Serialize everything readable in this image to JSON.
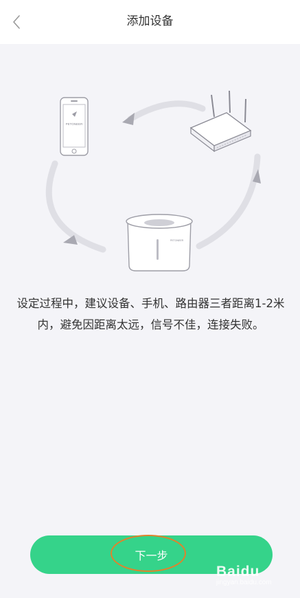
{
  "header": {
    "title": "添加设备",
    "back_icon": "chevron-left-icon"
  },
  "illustration": {
    "phone_brand": "PETONEER",
    "device_brand": "PETONEER"
  },
  "content": {
    "description": "设定过程中，建议设备、手机、路由器三者距离1-2米内，避免因距离太远，信号不佳，连接失败。"
  },
  "footer": {
    "next_label": "下一步",
    "button_color": "#35d38a",
    "highlight_color": "#e0822c"
  },
  "watermark": {
    "main": "Baidu",
    "sub": "jingyan.baidu.com"
  }
}
